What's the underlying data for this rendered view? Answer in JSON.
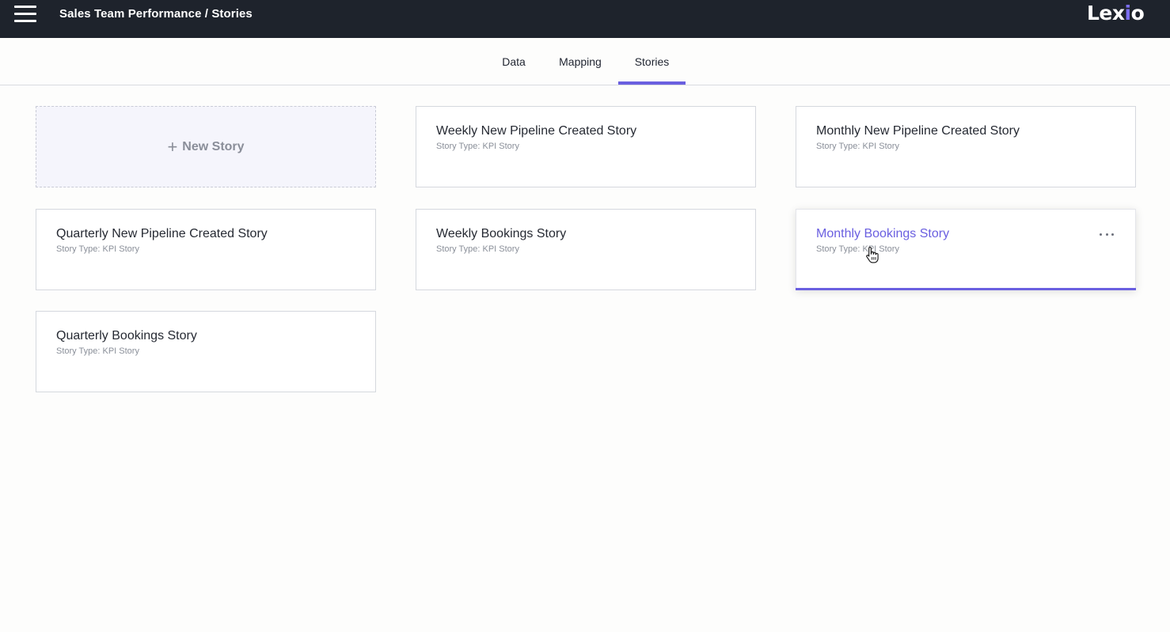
{
  "header": {
    "breadcrumb": "Sales Team Performance / Stories",
    "logo_main": "Lex",
    "logo_accent_char": "i",
    "logo_tail": "o",
    "menu_icon": "hamburger-menu-icon"
  },
  "tabs": [
    {
      "label": "Data",
      "active": false
    },
    {
      "label": "Mapping",
      "active": false
    },
    {
      "label": "Stories",
      "active": true
    }
  ],
  "new_story": {
    "icon": "plus-icon",
    "plus": "+",
    "label": "New Story"
  },
  "stories": [
    {
      "title": "Weekly New Pipeline Created Story",
      "subtitle": "Story Type: KPI Story"
    },
    {
      "title": "Monthly New Pipeline Created Story",
      "subtitle": "Story Type: KPI Story"
    },
    {
      "title": "Quarterly New Pipeline Created Story",
      "subtitle": "Story Type: KPI Story"
    },
    {
      "title": "Weekly Bookings Story",
      "subtitle": "Story Type: KPI Story"
    },
    {
      "title": "Monthly Bookings Story",
      "subtitle": "Story Type: KPI Story",
      "hovered": true,
      "menu_icon": "more-horizontal-icon"
    },
    {
      "title": "Quarterly Bookings Story",
      "subtitle": "Story Type: KPI Story"
    }
  ],
  "colors": {
    "topbar": "#1e232c",
    "accent": "#6a5fe0",
    "new_card_bg": "#f5f5fc",
    "subtitle_text": "#8a8f99"
  }
}
